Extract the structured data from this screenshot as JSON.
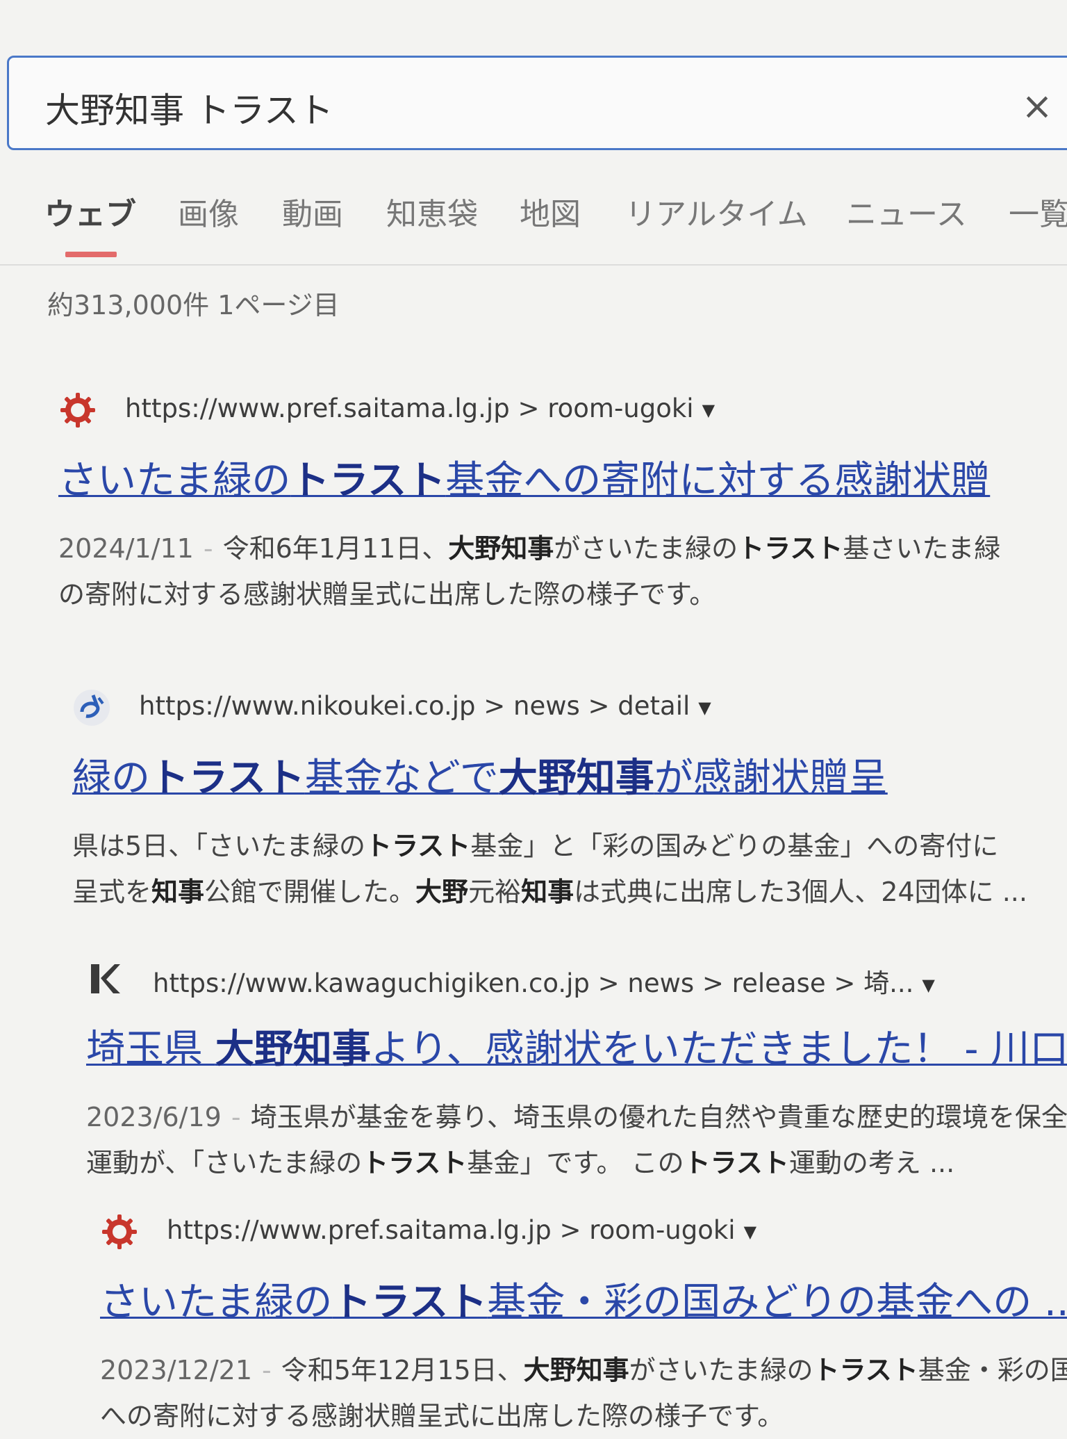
{
  "search": {
    "query": "大野知事 トラスト",
    "clear_label": "×"
  },
  "tabs": [
    {
      "label": "ウェブ"
    },
    {
      "label": "画像"
    },
    {
      "label": "動画"
    },
    {
      "label": "知恵袋"
    },
    {
      "label": "地図"
    },
    {
      "label": "リアルタイム"
    },
    {
      "label": "ニュース"
    },
    {
      "label": "一覧"
    }
  ],
  "result_count": "約313,000件  1ページ目",
  "results": [
    {
      "favicon": "saitama-emblem-icon",
      "url": "https://www.pref.saitama.lg.jp > room-ugoki",
      "title": [
        "さいたま緑の",
        "トラスト",
        "基金への寄附に対する感謝状贈"
      ],
      "date": "2024/1/11",
      "line1": [
        "令和6年1月11日、",
        "大野知事",
        "がさいたま緑の",
        "トラスト",
        "基さいたま緑"
      ],
      "line2": "の寄附に対する感謝状贈呈式に出席した際の様子です。"
    },
    {
      "favicon": "nikoukei-logo-icon",
      "url": "https://www.nikoukei.co.jp > news > detail",
      "title": [
        "緑の",
        "トラスト",
        "基金などで",
        "大野知事",
        "が感謝状贈呈"
      ],
      "line1": [
        "県は5日、「さいたま緑の",
        "トラスト",
        "基金」と「彩の国みどりの基金」への寄付に"
      ],
      "line2": [
        "呈式を",
        "知事",
        "公館で開催した。",
        "大野",
        "元裕",
        "知事",
        "は式典に出席した3個人、24団体に ..."
      ]
    },
    {
      "favicon": "kawaguchigiken-logo-icon",
      "url": "https://www.kawaguchigiken.co.jp > news > release > 埼...",
      "title": [
        "埼玉県 ",
        "大野知事",
        "より、感謝状をいただきました！ - 川口"
      ],
      "date": "2023/6/19",
      "line1": "埼玉県が基金を募り、埼玉県の優れた自然や貴重な歴史的環境を保全",
      "line2": [
        "運動が、「さいたま緑の",
        "トラスト",
        "基金」です。 この",
        "トラスト",
        "運動の考え ..."
      ]
    },
    {
      "favicon": "saitama-emblem-icon",
      "url": "https://www.pref.saitama.lg.jp > room-ugoki",
      "title": [
        "さいたま緑の",
        "トラスト",
        "基金・彩の国みどりの基金への ..."
      ],
      "date": "2023/12/21",
      "line1": [
        "令和5年12月15日、",
        "大野知事",
        "がさいたま緑の",
        "トラスト",
        "基金・彩の国み"
      ],
      "line2": "への寄附に対する感謝状贈呈式に出席した際の様子です。"
    }
  ],
  "colors": {
    "link": "#2a47a8",
    "accent": "#e36b6b",
    "search_border": "#4a78c8"
  }
}
